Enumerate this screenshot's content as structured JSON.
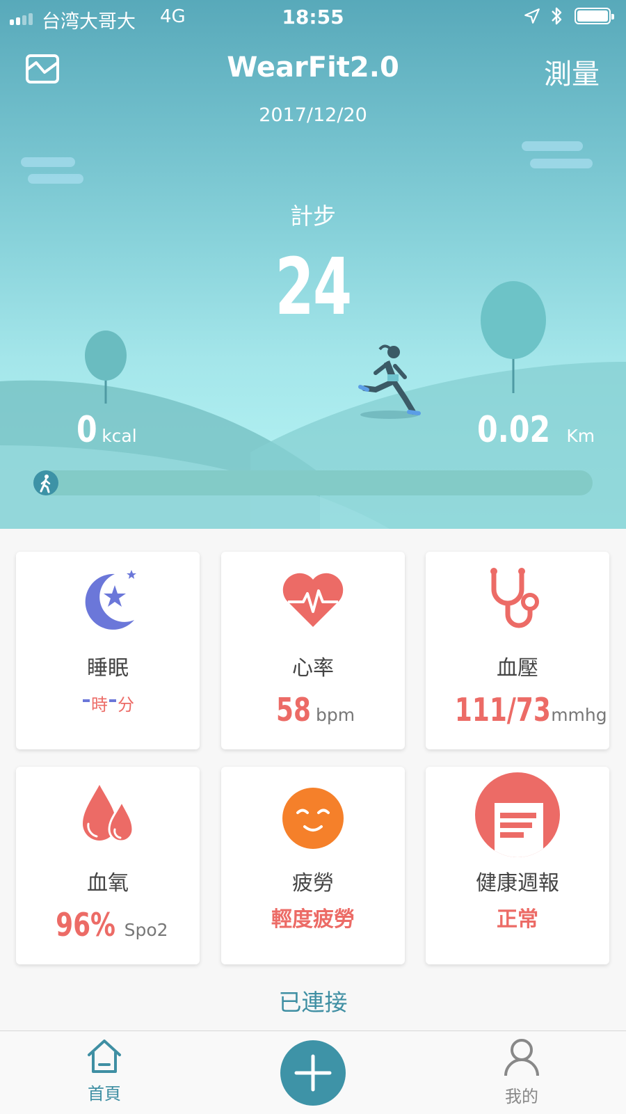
{
  "status_bar": {
    "carrier": "台湾大哥大",
    "network": "4G",
    "time": "18:55"
  },
  "header": {
    "title": "WearFit2.0",
    "measure_label": "測量",
    "date": "2017/12/20"
  },
  "steps": {
    "label": "計步",
    "value": "24",
    "calories": "0",
    "calories_unit": "kcal",
    "distance": "0.02",
    "distance_unit": "Km",
    "goal_progress": 0.0
  },
  "cards": {
    "sleep": {
      "label": "睡眠",
      "hours_unit": "時",
      "minutes_unit": "分"
    },
    "heart_rate": {
      "label": "心率",
      "value": "58",
      "unit": "bpm"
    },
    "blood_pressure": {
      "label": "血壓",
      "value": "111/73",
      "unit": "mmhg"
    },
    "blood_oxygen": {
      "label": "血氧",
      "value": "96%",
      "unit": "Spo2"
    },
    "fatigue": {
      "label": "疲勞",
      "value": "輕度疲勞"
    },
    "health_report": {
      "label": "健康週報",
      "value": "正常"
    }
  },
  "connection_status": "已連接",
  "tabbar": {
    "home": "首頁",
    "mine": "我的"
  },
  "colors": {
    "accent": "#3e93a7",
    "value_red": "#ec6b66",
    "sleep_purple": "#6b77d9",
    "fatigue_orange": "#f5802a"
  }
}
